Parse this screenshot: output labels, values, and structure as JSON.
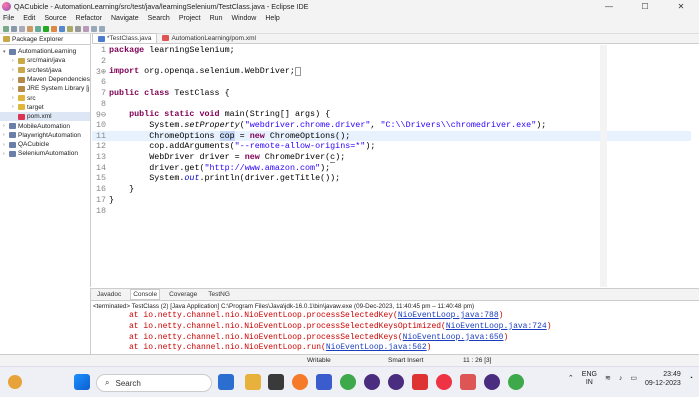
{
  "window": {
    "title": "QACubicle - AutomationLearning/src/test/java/learningSelenium/TestClass.java - Eclipse IDE",
    "min": "—",
    "max": "☐",
    "close": "✕"
  },
  "menu": [
    "File",
    "Edit",
    "Source",
    "Refactor",
    "Navigate",
    "Search",
    "Project",
    "Run",
    "Window",
    "Help"
  ],
  "explorer": {
    "tab_label": "Package Explorer",
    "tree": [
      {
        "label": "AutomationLearning",
        "depth": 0,
        "expanded": true,
        "icon": "project-icon"
      },
      {
        "label": "src/main/java",
        "depth": 1,
        "icon": "source-folder-icon"
      },
      {
        "label": "src/test/java",
        "depth": 1,
        "icon": "source-folder-icon"
      },
      {
        "label": "Maven Dependencies",
        "depth": 1,
        "icon": "library-icon"
      },
      {
        "label": "JRE System Library [j",
        "depth": 1,
        "icon": "library-icon"
      },
      {
        "label": "src",
        "depth": 1,
        "icon": "folder-icon"
      },
      {
        "label": "target",
        "depth": 1,
        "icon": "folder-icon"
      },
      {
        "label": "pom.xml",
        "depth": 1,
        "icon": "xml-file-icon",
        "selected": true
      },
      {
        "label": "MobileAutomation",
        "depth": 0,
        "icon": "project-icon"
      },
      {
        "label": "PlaywrightAutomation",
        "depth": 0,
        "icon": "project-icon"
      },
      {
        "label": "QACubicle",
        "depth": 0,
        "icon": "project-icon"
      },
      {
        "label": "SeleniumAutomation",
        "depth": 0,
        "icon": "project-icon"
      }
    ]
  },
  "editor_tabs": [
    {
      "label": "*TestClass.java",
      "active": true
    },
    {
      "label": "AutomationLearning/pom.xml",
      "active": false
    }
  ],
  "code_lines": [
    {
      "n": "1",
      "html": "<span class=\"kw\">package</span> learningSelenium;"
    },
    {
      "n": "2",
      "html": ""
    },
    {
      "n": "3⊕",
      "html": "<span class=\"kw\">import</span> org.openqa.selenium.WebDriver;<span style=\"border:1px solid #999;font-size:6px\">&nbsp;</span>"
    },
    {
      "n": "6",
      "html": ""
    },
    {
      "n": "7",
      "html": "<span class=\"kw\">public class</span> TestClass {"
    },
    {
      "n": "8",
      "html": ""
    },
    {
      "n": "9⊖",
      "html": "    <span class=\"kw\">public static void</span> main(String[] args) {"
    },
    {
      "n": "10",
      "html": "        System.<span class=\"it\">setProperty</span>(<span class=\"str\">\"webdriver.chrome.driver\"</span>, <span class=\"str\">\"C:\\\\Drivers\\\\chromedriver.exe\"</span>);"
    },
    {
      "n": "11",
      "html": "        ChromeOptions <span class=\"sel\">cop</span> = <span class=\"kw\">new</span> ChromeOptions();",
      "hl": true
    },
    {
      "n": "12",
      "html": "        cop.addArguments(<span class=\"str\">\"--remote-allow-origins=*\"</span>);"
    },
    {
      "n": "13",
      "html": "        WebDriver driver = <span class=\"kw\">new</span> ChromeDriver(<span style=\"border-bottom:1px solid #888\">c</span>);"
    },
    {
      "n": "14",
      "html": "        driver.get(<span class=\"str\">\"http://www.amazon.com\"</span>);"
    },
    {
      "n": "15",
      "html": "        System.<span class=\"fld\">out</span>.println(driver.getTitle());"
    },
    {
      "n": "16",
      "html": "    }"
    },
    {
      "n": "17",
      "html": "}"
    },
    {
      "n": "18",
      "html": ""
    }
  ],
  "console": {
    "tabs": [
      "Javadoc",
      "Console",
      "Coverage",
      "TestNG"
    ],
    "active_tab": "Console",
    "status": "<terminated> TestClass (2) [Java Application] C:\\Program Files\\Java\\jdk-16.0.1\\bin\\javaw.exe  (09-Dec-2023, 11:40:45 pm – 11:40:48 pm)",
    "lines": [
      {
        "pre": "at io.netty.channel.nio.NioEventLoop.processSelectedKey(",
        "link": "NioEventLoop.java:788",
        "post": ")"
      },
      {
        "pre": "at io.netty.channel.nio.NioEventLoop.processSelectedKeysOptimized(",
        "link": "NioEventLoop.java:724",
        "post": ")"
      },
      {
        "pre": "at io.netty.channel.nio.NioEventLoop.processSelectedKeys(",
        "link": "NioEventLoop.java:650",
        "post": ")"
      },
      {
        "pre": "at io.netty.channel.nio.NioEventLoop.run(",
        "link": "NioEventLoop.java:562",
        "post": ")"
      }
    ]
  },
  "status": {
    "writable": "Writable",
    "insert": "Smart Insert",
    "position": "11 : 26 [3]"
  },
  "taskbar": {
    "search_placeholder": "Search",
    "lang": "ENG",
    "lang2": "IN",
    "time": "23:49",
    "date": "09-12-2023"
  },
  "colors": {
    "keyword": "#7f0055",
    "string": "#2a00ff",
    "selection": "#c4d8f6",
    "error": "#cc0000",
    "link": "#1a3dbf"
  }
}
